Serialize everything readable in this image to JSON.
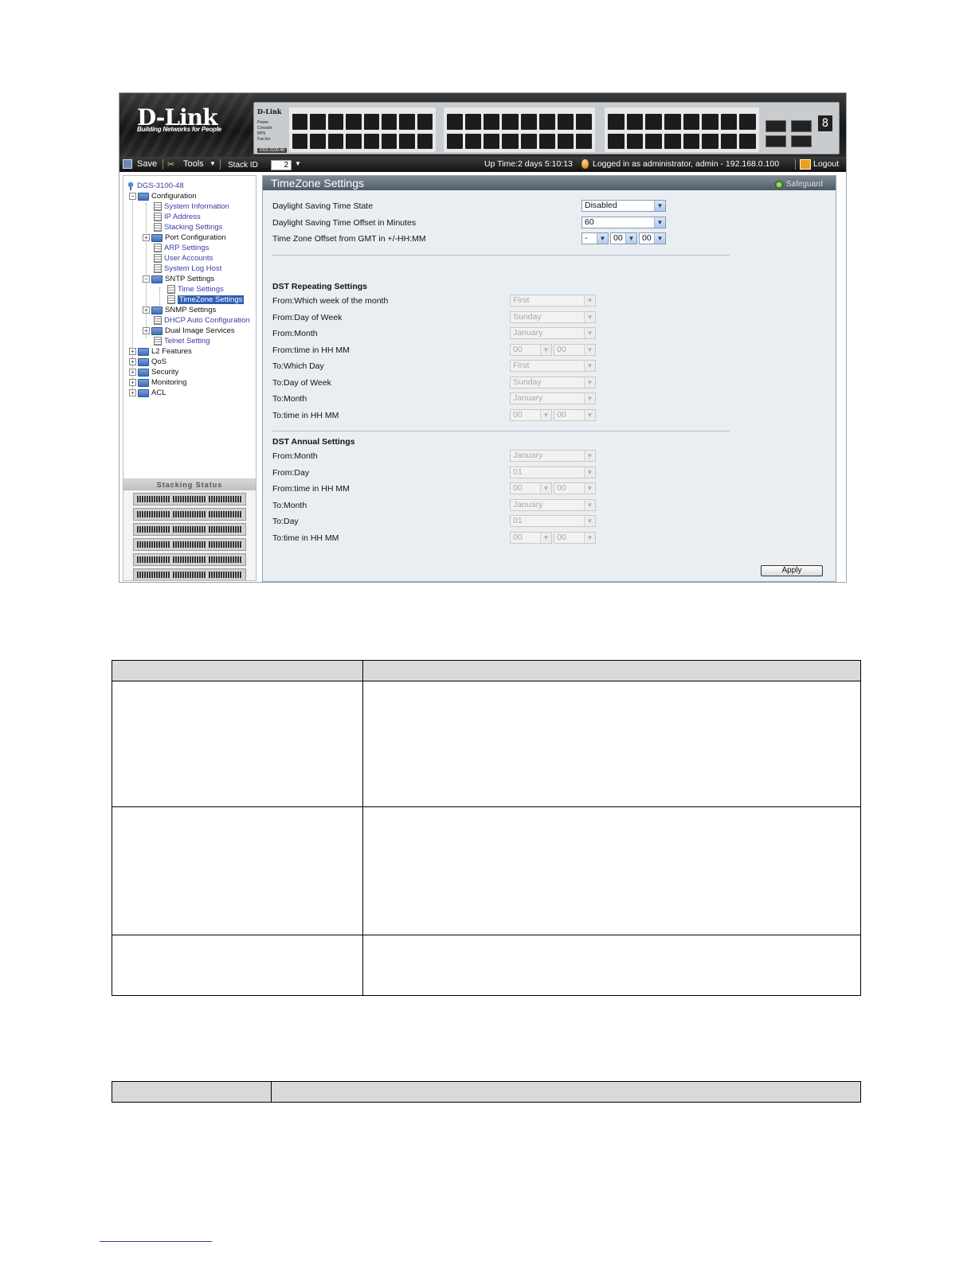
{
  "banner": {
    "logo": "D-Link",
    "tagline": "Building Networks for People",
    "panel_brand": "D-Link",
    "panel_leds": [
      "Power",
      "Console",
      "RPS",
      "Fan Err"
    ],
    "panel_model": "DGS-3100-48",
    "unit_digit": "8"
  },
  "toolbar": {
    "save": "Save",
    "tools": "Tools",
    "stack_id_label": "Stack ID",
    "stack_id_value": "2",
    "uptime": "Up Time:2 days 5:10:13",
    "logged_in": "Logged in as administrator, admin - 192.168.0.100",
    "logout": "Logout"
  },
  "tree": {
    "root": "DGS-3100-48",
    "configuration": "Configuration",
    "system_information": "System Information",
    "ip_address": "IP Address",
    "stacking_settings": "Stacking Settings",
    "port_configuration": "Port Configuration",
    "arp_settings": "ARP Settings",
    "user_accounts": "User Accounts",
    "system_log_host": "System Log Host",
    "sntp_settings": "SNTP Settings",
    "time_settings": "Time Settings",
    "timezone_settings": "TimeZone Settings",
    "snmp_settings": "SNMP Settings",
    "dhcp_auto_configuration": "DHCP Auto Configuration",
    "dual_image_services": "Dual Image Services",
    "telnet_setting": "Telnet Setting",
    "l2_features": "L2 Features",
    "qos": "QoS",
    "security": "Security",
    "monitoring": "Monitoring",
    "acl": "ACL"
  },
  "stacking_status": {
    "title": "Stacking Status"
  },
  "main": {
    "title": "TimeZone Settings",
    "safeguard": "Safeguard",
    "dst_state_label": "Daylight Saving Time State",
    "dst_state_value": "Disabled",
    "dst_offset_label": "Daylight Saving Time Offset in Minutes",
    "dst_offset_value": "60",
    "tz_offset_label": "Time Zone Offset from GMT in +/-HH:MM",
    "tz_sign": "-",
    "tz_hh": "00",
    "tz_mm": "00",
    "repeating_title": "DST Repeating Settings",
    "rep_from_week_label": "From:Which week of the month",
    "rep_from_week_value": "First",
    "rep_from_dow_label": "From:Day of Week",
    "rep_from_dow_value": "Sunday",
    "rep_from_month_label": "From:Month",
    "rep_from_month_value": "January",
    "rep_from_time_label": "From:time in HH MM",
    "rep_from_hh": "00",
    "rep_from_mm": "00",
    "rep_to_day_label": "To:Which Day",
    "rep_to_day_value": "First",
    "rep_to_dow_label": "To:Day of Week",
    "rep_to_dow_value": "Sunday",
    "rep_to_month_label": "To:Month",
    "rep_to_month_value": "January",
    "rep_to_time_label": "To:time in HH MM",
    "rep_to_hh": "00",
    "rep_to_mm": "00",
    "annual_title": "DST Annual Settings",
    "ann_from_month_label": "From:Month",
    "ann_from_month_value": "January",
    "ann_from_day_label": "From:Day",
    "ann_from_day_value": "01",
    "ann_from_time_label": "From:time in HH MM",
    "ann_from_hh": "00",
    "ann_from_mm": "00",
    "ann_to_month_label": "To:Month",
    "ann_to_month_value": "January",
    "ann_to_day_label": "To:Day",
    "ann_to_day_value": "01",
    "ann_to_time_label": "To:time in HH MM",
    "ann_to_hh": "00",
    "ann_to_mm": "00",
    "apply": "Apply"
  }
}
